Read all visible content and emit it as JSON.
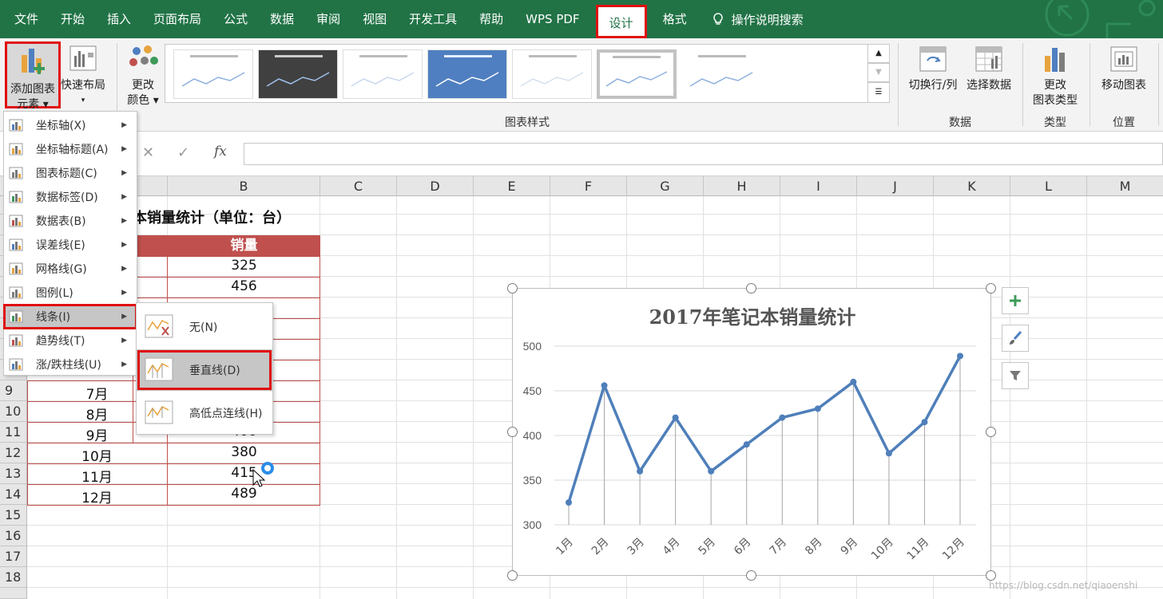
{
  "tabs": [
    "文件",
    "开始",
    "插入",
    "页面布局",
    "公式",
    "数据",
    "审阅",
    "视图",
    "开发工具",
    "帮助",
    "WPS PDF",
    "设计",
    "格式"
  ],
  "active_tab": "设计",
  "tell_me": "操作说明搜索",
  "ribbon": {
    "add_element_line1": "添加图表",
    "add_element_line2": "元素",
    "quick_layout": "快速布局",
    "change_color_line1": "更改",
    "change_color_line2": "颜色",
    "chart_styles_label": "图表样式",
    "switch_row_col": "切换行/列",
    "select_data": "选择数据",
    "data_group": "数据",
    "change_type_line1": "更改",
    "change_type_line2": "图表类型",
    "type_group": "类型",
    "move_chart": "移动图表",
    "location_group": "位置"
  },
  "formula_bar": {
    "fx": "fx",
    "cancel": "✕",
    "enter": "✓"
  },
  "columns": [
    "B",
    "C",
    "D",
    "E",
    "F",
    "G",
    "H",
    "I",
    "J",
    "K",
    "L",
    "M"
  ],
  "rows": [
    "9",
    "10",
    "11",
    "12",
    "13",
    "14",
    "15",
    "16",
    "17",
    "18"
  ],
  "table": {
    "title": "本销量统计（单位：台）",
    "header_sales": "销量",
    "sales_top": [
      "325",
      "456"
    ],
    "months": [
      "7月",
      "8月",
      "9月",
      "10月",
      "11月",
      "12月"
    ],
    "sales_bottom": [
      "",
      "",
      "400",
      "380",
      "415",
      "489"
    ]
  },
  "menu": [
    {
      "label": "坐标轴(X)",
      "key": "axes"
    },
    {
      "label": "坐标轴标题(A)",
      "key": "axis-titles"
    },
    {
      "label": "图表标题(C)",
      "key": "chart-title"
    },
    {
      "label": "数据标签(D)",
      "key": "data-labels"
    },
    {
      "label": "数据表(B)",
      "key": "data-table"
    },
    {
      "label": "误差线(E)",
      "key": "error-bars"
    },
    {
      "label": "网格线(G)",
      "key": "gridlines"
    },
    {
      "label": "图例(L)",
      "key": "legend"
    },
    {
      "label": "线条(I)",
      "key": "lines"
    },
    {
      "label": "趋势线(T)",
      "key": "trendline"
    },
    {
      "label": "涨/跌柱线(U)",
      "key": "up-down-bars"
    }
  ],
  "submenu": [
    {
      "label": "无(N)",
      "key": "none"
    },
    {
      "label": "垂直线(D)",
      "key": "drop-lines"
    },
    {
      "label": "高低点连线(H)",
      "key": "high-low-lines"
    }
  ],
  "chart_data": {
    "type": "line",
    "title": "2017年笔记本销量统计",
    "categories": [
      "1月",
      "2月",
      "3月",
      "4月",
      "5月",
      "6月",
      "7月",
      "8月",
      "9月",
      "10月",
      "11月",
      "12月"
    ],
    "series": [
      {
        "values": [
          325,
          456,
          360,
          420,
          360,
          390,
          420,
          430,
          460,
          380,
          415,
          489
        ]
      }
    ],
    "ylim": [
      300,
      500
    ],
    "yticks": [
      300,
      350,
      400,
      450,
      500
    ],
    "grid": true,
    "drop_lines": true,
    "line_color": "#4f7fba"
  },
  "watermark": "https://blog.csdn.net/qiaoenshi"
}
